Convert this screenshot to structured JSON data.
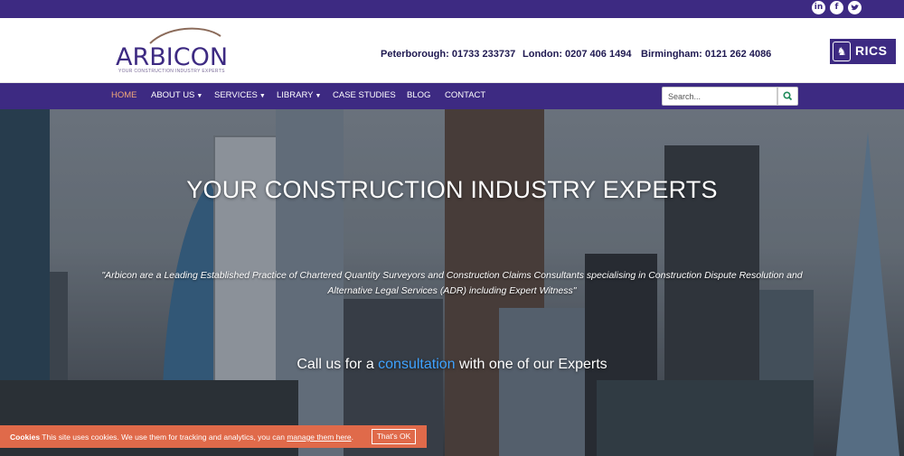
{
  "topbar": {
    "social": [
      {
        "name": "linkedin",
        "glyph": "in"
      },
      {
        "name": "facebook",
        "glyph": "f"
      },
      {
        "name": "twitter",
        "glyph": "t"
      }
    ]
  },
  "header": {
    "logo_text": "ARBICON",
    "logo_tagline": "YOUR CONSTRUCTION INDUSTRY EXPERTS",
    "contacts": [
      {
        "label": "Peterborough: 01733 233737"
      },
      {
        "label": "London: 0207 406 1494"
      },
      {
        "label": "Birmingham: 0121 262 4086"
      }
    ],
    "rics_label": "RICS"
  },
  "nav": {
    "items": [
      {
        "label": "HOME"
      },
      {
        "label": "ABOUT US"
      },
      {
        "label": "SERVICES"
      },
      {
        "label": "LIBRARY"
      },
      {
        "label": "CASE STUDIES"
      },
      {
        "label": "BLOG"
      },
      {
        "label": "CONTACT"
      }
    ],
    "search_placeholder": "Search..."
  },
  "hero": {
    "title": "YOUR CONSTRUCTION INDUSTRY EXPERTS",
    "quote": "\"Arbicon are a Leading Established Practice of Chartered Quantity Surveyors and Construction Claims Consultants specialising in Construction Dispute Resolution and Alternative Legal Services (ADR) including Expert Witness\"",
    "cta_before": "Call us for a ",
    "cta_link": "consultation",
    "cta_after": " with one of our Experts"
  },
  "cookie": {
    "title": "Cookies",
    "text": " This site uses cookies. We use them for tracking and analytics, you can ",
    "link": "manage them here",
    "end": ".",
    "button": "That's OK"
  },
  "colors": {
    "brand": "#3d2a82",
    "active_nav": "#f1a67a",
    "cta_link": "#3fa2ff",
    "cookie_bar": "#e06a4a"
  }
}
